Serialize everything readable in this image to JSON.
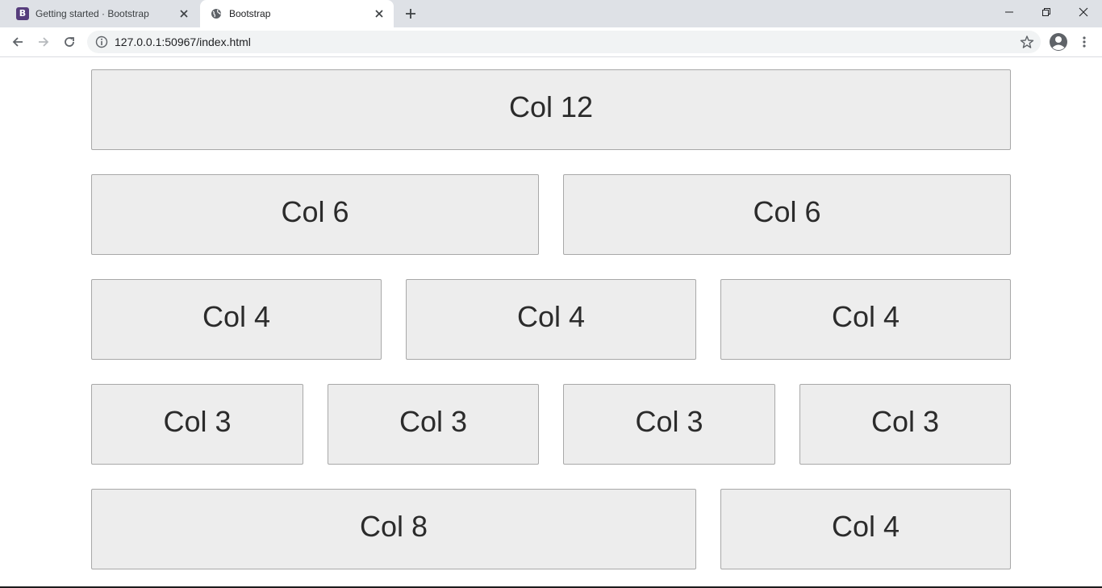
{
  "browser": {
    "tabs": [
      {
        "title": "Getting started · Bootstrap",
        "favicon": "bootstrap-logo-icon",
        "favicon_text": "B",
        "active": false
      },
      {
        "title": "Bootstrap",
        "favicon": "globe-icon",
        "active": true
      }
    ],
    "url": "127.0.0.1:50967/index.html"
  },
  "grid": {
    "rows": [
      [
        "Col 12"
      ],
      [
        "Col 6",
        "Col 6"
      ],
      [
        "Col 4",
        "Col 4",
        "Col 4"
      ],
      [
        "Col 3",
        "Col 3",
        "Col 3",
        "Col 3"
      ],
      [
        "Col 8",
        "Col 4"
      ]
    ]
  },
  "colors": {
    "col_background": "#ededed",
    "col_border": "#a8a8a8",
    "col_text": "#2b2b2b",
    "bootstrap_brand": "#563d7c"
  }
}
